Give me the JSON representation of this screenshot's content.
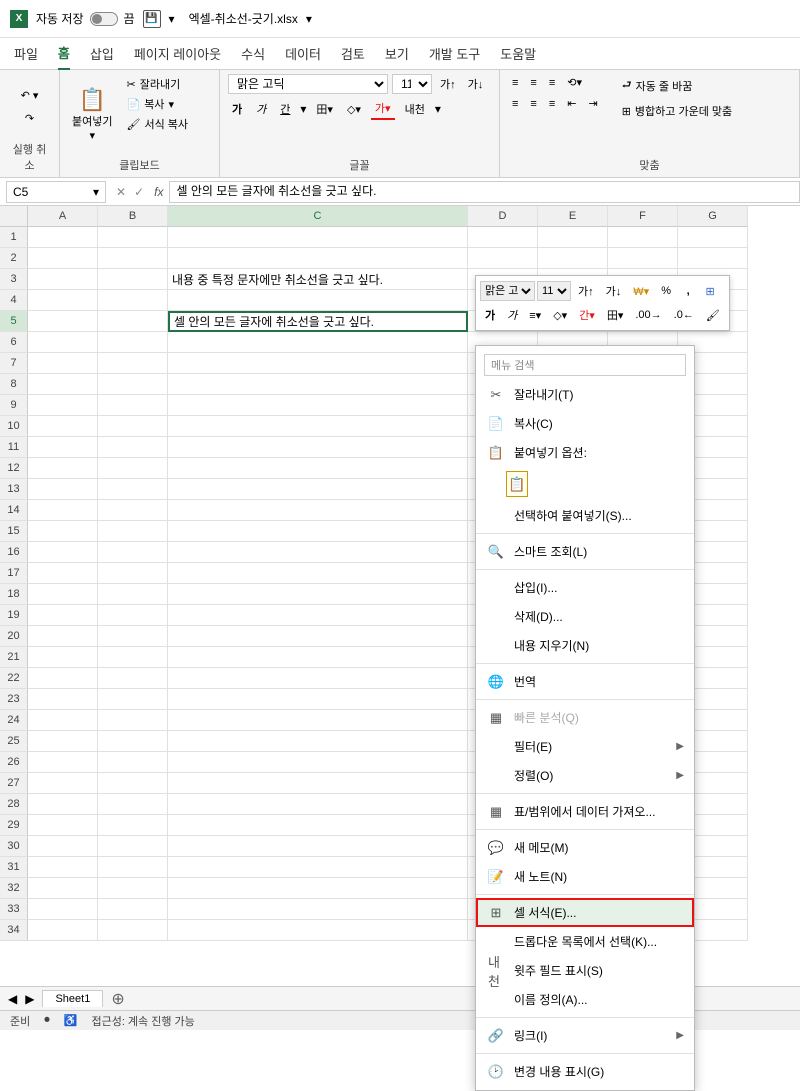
{
  "titlebar": {
    "autosave_label": "자동 저장",
    "autosave_state": "끔",
    "filename": "엑셀-취소선-긋기.xlsx"
  },
  "tabs": {
    "file": "파일",
    "home": "홈",
    "insert": "삽입",
    "layout": "페이지 레이아웃",
    "formula": "수식",
    "data": "데이터",
    "review": "검토",
    "view": "보기",
    "developer": "개발 도구",
    "help": "도움말"
  },
  "ribbon": {
    "undo_group": "실행 취소",
    "clipboard_group": "클립보드",
    "paste": "붙여넣기",
    "cut": "잘라내기",
    "copy": "복사",
    "format_painter": "서식 복사",
    "font_group": "글꼴",
    "font_name": "맑은 고딕",
    "font_size": "11",
    "bold": "가",
    "italic": "가",
    "underline": "간",
    "ruby": "내천",
    "align_group": "맞춤",
    "wrap": "자동 줄 바꿈",
    "merge": "병합하고 가운데 맞춤"
  },
  "formula_bar": {
    "cell_ref": "C5",
    "fx": "fx",
    "value": "셀 안의 모든 글자에 취소선을 긋고 싶다."
  },
  "columns": [
    "A",
    "B",
    "C",
    "D",
    "E",
    "F",
    "G"
  ],
  "rows_count": 34,
  "selected_row": 5,
  "selected_col": "C",
  "cell_c3": "내용 중 특정 문자에만 취소선을 긋고 싶다.",
  "cell_c5": "셀 안의 모든 글자에 취소선을 긋고 싶다.",
  "mini": {
    "font": "맑은 고딕",
    "size": "11",
    "bold": "가",
    "italic": "가"
  },
  "context": {
    "search": "메뉴 검색",
    "cut": "잘라내기(T)",
    "copy": "복사(C)",
    "paste_options": "붙여넣기 옵션:",
    "paste_special": "선택하여 붙여넣기(S)...",
    "smart_lookup": "스마트 조회(L)",
    "insert": "삽입(I)...",
    "delete": "삭제(D)...",
    "clear": "내용 지우기(N)",
    "translate": "번역",
    "quick_analysis": "빠른 분석(Q)",
    "filter": "필터(E)",
    "sort": "정렬(O)",
    "get_data": "표/범위에서 데이터 가져오...",
    "new_memo": "새 메모(M)",
    "new_note": "새 노트(N)",
    "format_cells": "셀 서식(E)...",
    "pick_dropdown": "드롭다운 목록에서 선택(K)...",
    "show_phonetic": "윗주 필드 표시(S)",
    "define_name": "이름 정의(A)...",
    "link": "링크(I)",
    "show_changes": "변경 내용 표시(G)"
  },
  "sheets": {
    "sheet1": "Sheet1"
  },
  "statusbar": {
    "ready": "준비",
    "accessibility": "접근성: 계속 진행 가능"
  }
}
